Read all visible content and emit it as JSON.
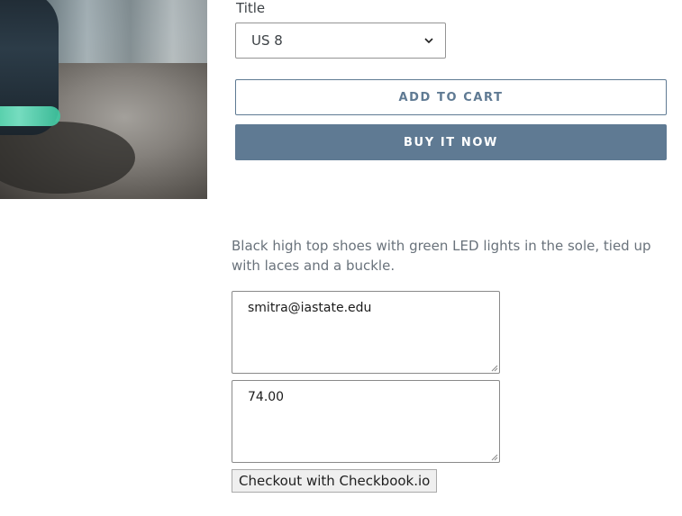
{
  "product": {
    "image_alt_icon": "product-photo",
    "variant_label": "Title",
    "variant_selected": "US 8",
    "add_to_cart": "ADD TO CART",
    "buy_now": "BUY IT NOW",
    "description": "Black high top shoes with green LED lights in the sole, tied up with laces and a buckle."
  },
  "checkout": {
    "email_value": "smitra@iastate.edu",
    "amount_value": "74.00",
    "button_label": "Checkout with Checkbook.io"
  },
  "colors": {
    "accent": "#5f7a93",
    "text": "#3d4246",
    "muted_text": "#69727b"
  }
}
